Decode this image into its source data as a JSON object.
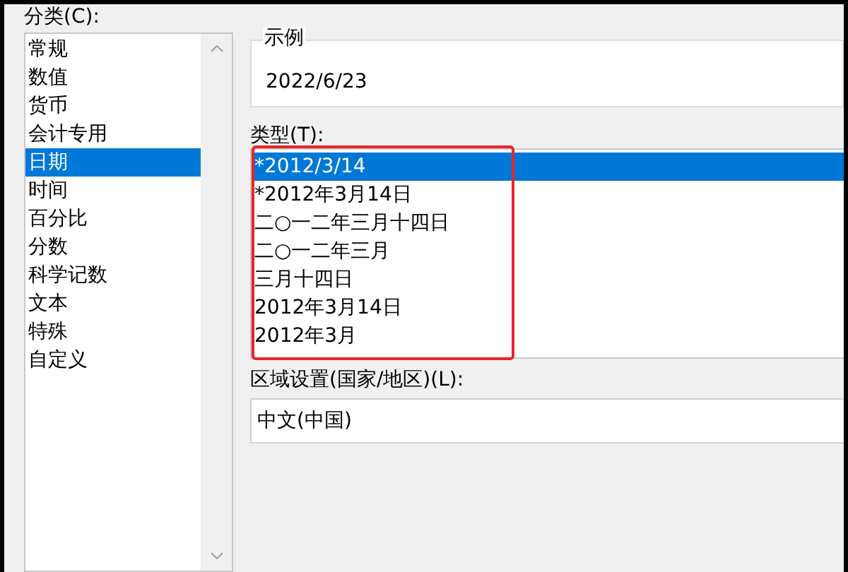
{
  "category": {
    "label": "分类(C):",
    "items": [
      {
        "label": "常规",
        "selected": false
      },
      {
        "label": "数值",
        "selected": false
      },
      {
        "label": "货币",
        "selected": false
      },
      {
        "label": "会计专用",
        "selected": false
      },
      {
        "label": "日期",
        "selected": true
      },
      {
        "label": "时间",
        "selected": false
      },
      {
        "label": "百分比",
        "selected": false
      },
      {
        "label": "分数",
        "selected": false
      },
      {
        "label": "科学记数",
        "selected": false
      },
      {
        "label": "文本",
        "selected": false
      },
      {
        "label": "特殊",
        "selected": false
      },
      {
        "label": "自定义",
        "selected": false
      }
    ]
  },
  "sample": {
    "label": "示例",
    "value": "2022/6/23"
  },
  "type": {
    "label": "类型(T):",
    "items": [
      {
        "label": "*2012/3/14",
        "selected": true
      },
      {
        "label": "*2012年3月14日",
        "selected": false
      },
      {
        "label": "二○一二年三月十四日",
        "selected": false
      },
      {
        "label": "二○一二年三月",
        "selected": false
      },
      {
        "label": "三月十四日",
        "selected": false
      },
      {
        "label": "2012年3月14日",
        "selected": false
      },
      {
        "label": "2012年3月",
        "selected": false
      }
    ]
  },
  "locale": {
    "label": "区域设置(国家/地区)(L):",
    "value": "中文(中国)"
  }
}
